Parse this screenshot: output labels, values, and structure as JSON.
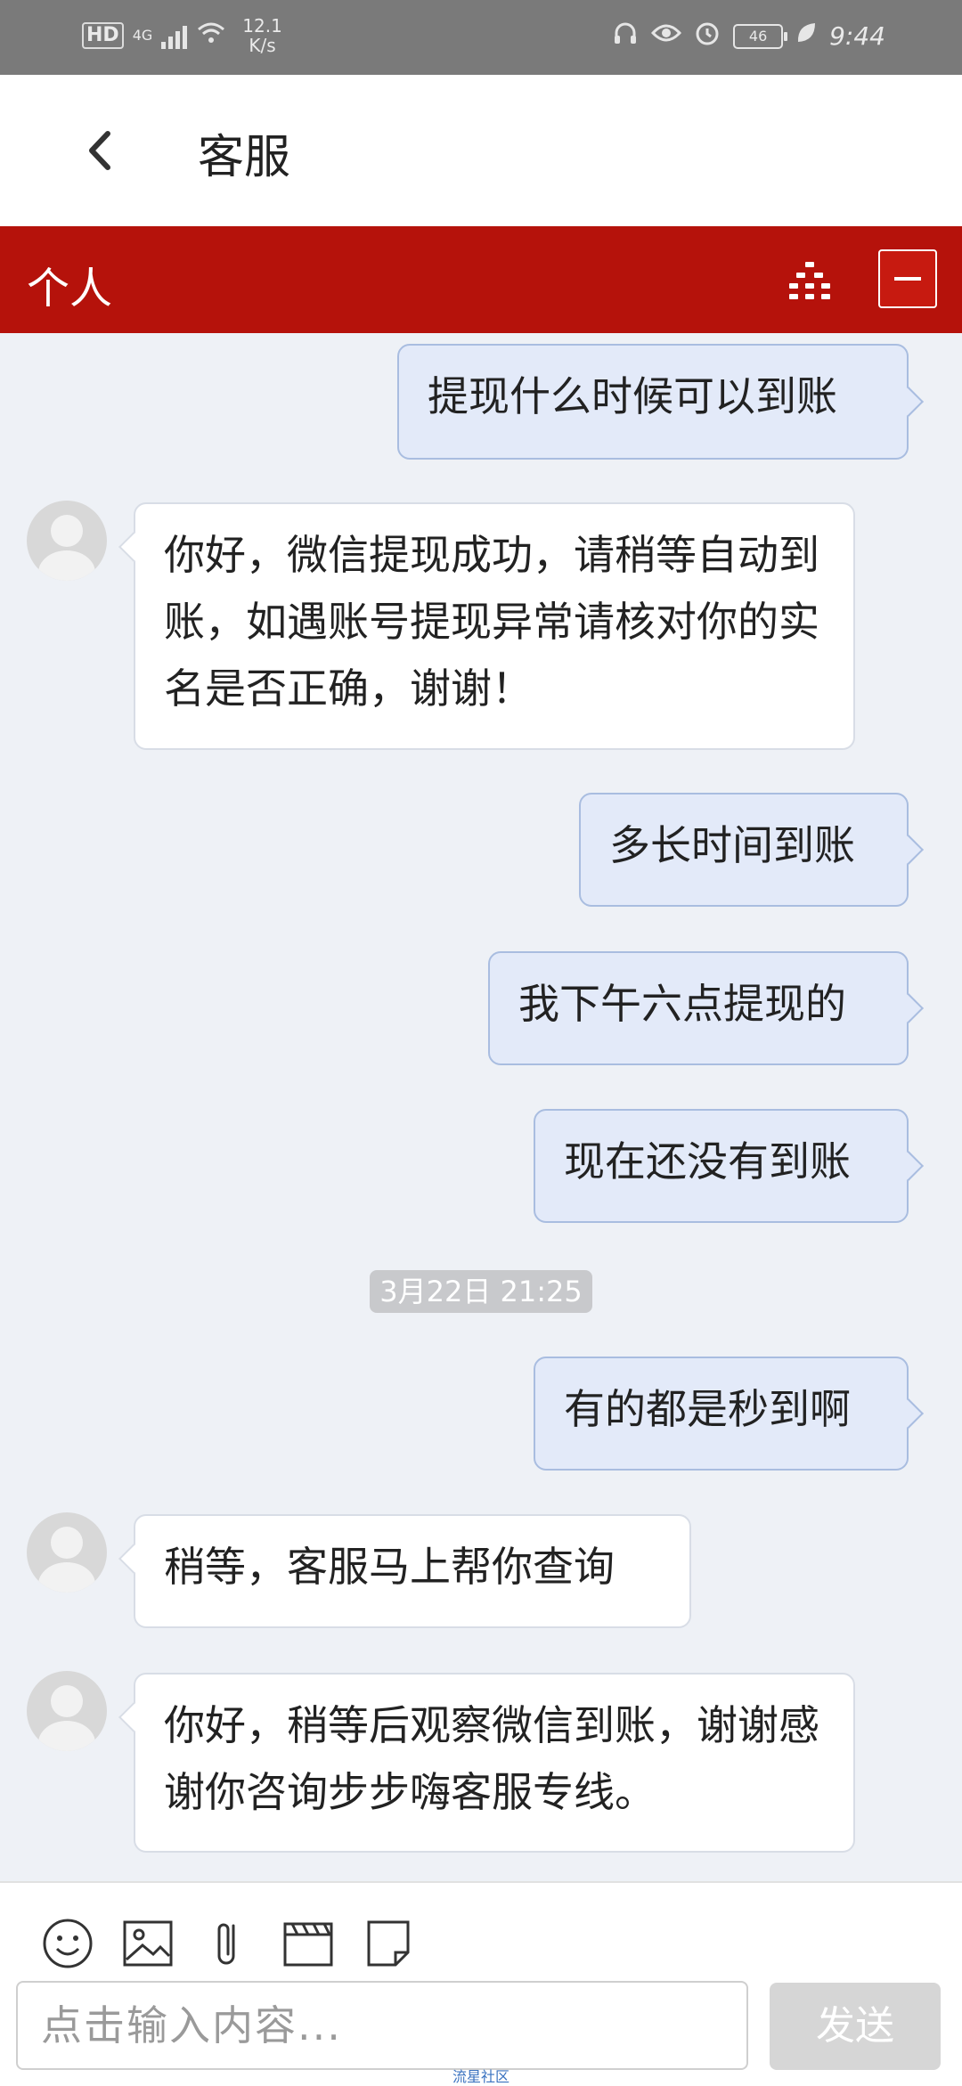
{
  "status_bar": {
    "hd": "HD",
    "network": "4G",
    "speed_value": "12.1",
    "speed_unit": "K/s",
    "battery": "46",
    "time": "9:44"
  },
  "header": {
    "title": "客服",
    "back_icon": "chevron-left-icon"
  },
  "panel": {
    "title": "个人"
  },
  "messages": [
    {
      "side": "right",
      "text": "提现什么时候可以到账"
    },
    {
      "side": "left",
      "text": "你好，微信提现成功，请稍等自动到账，如遇账号提现异常请核对你的实名是否正确，谢谢！"
    },
    {
      "side": "right",
      "text": "多长时间到账"
    },
    {
      "side": "right",
      "text": "我下午六点提现的"
    },
    {
      "side": "right",
      "text": "现在还没有到账"
    },
    {
      "side": "timestamp",
      "text": "3月22日 21:25"
    },
    {
      "side": "right",
      "text": "有的都是秒到啊"
    },
    {
      "side": "left",
      "text": "稍等，客服马上帮你查询"
    },
    {
      "side": "left",
      "text": "你好，稍等后观察微信到账，谢谢感谢你咨询步步嗨客服专线。"
    }
  ],
  "input": {
    "placeholder": "点击输入内容...",
    "send_label": "发送",
    "tools": [
      "smiley-icon",
      "image-icon",
      "attachment-icon",
      "video-icon",
      "file-icon"
    ]
  },
  "watermark": "流星社区",
  "colors": {
    "header_red": "#b5120b",
    "bubble_right": "#e3eaf9",
    "background": "#eef1f6"
  }
}
